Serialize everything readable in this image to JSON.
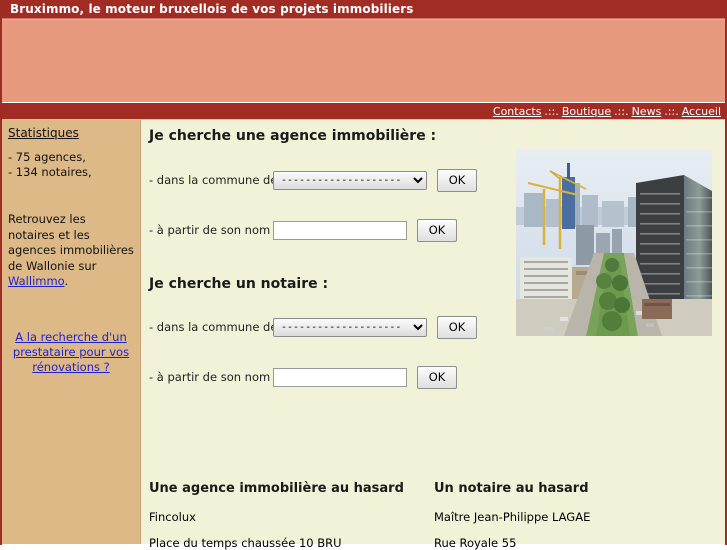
{
  "window": {
    "title": "Bruximmo, le moteur bruxellois de vos projets immobiliers"
  },
  "nav": {
    "separator": ".::.",
    "links": [
      {
        "label": "Contacts"
      },
      {
        "label": "Boutique"
      },
      {
        "label": "News"
      },
      {
        "label": "Accueil"
      }
    ]
  },
  "sidebar": {
    "stats_title": "Statistiques",
    "stats": [
      "- 75 agences,",
      "- 134 notaires,"
    ],
    "promo_before": "Retrouvez les notaires et les agences immobilières de Wallonie sur ",
    "promo_link": "Wallimmo",
    "promo_after": ".",
    "reno_link_line1": "A la recherche d'un",
    "reno_link_line2": "prestataire pour vos",
    "reno_link_line3": "rénovations ?"
  },
  "main": {
    "agency_section": {
      "heading": "Je cherche une agence immobilière :",
      "commune_label": "- dans la commune de",
      "commune_value": "--------------------",
      "commune_ok": "OK",
      "name_label": "- à partir de son nom",
      "name_value": "",
      "name_placeholder": "",
      "name_ok": "OK"
    },
    "notary_section": {
      "heading": "Je cherche un notaire :",
      "commune_label": "- dans la commune de",
      "commune_value": "--------------------",
      "commune_ok": "OK",
      "name_label": "- à partir de son nom",
      "name_value": "",
      "name_placeholder": "",
      "name_ok": "OK"
    },
    "random_agency": {
      "heading": "Une agence immobilière au hasard",
      "name": "Fincolux",
      "address": "Place du temps chaussée 10 BRU"
    },
    "random_notary": {
      "heading": "Un notaire au hasard",
      "name": "Maître Jean-Philippe LAGAE",
      "address": "Rue Royale 55"
    },
    "photo_alt": "brussels-cityscape-photo"
  },
  "colors": {
    "title_bar": "#a02c24",
    "banner": "#e89a7e",
    "sidebar": "#ddb988",
    "main_bg": "#f2f2d8",
    "link": "#2222cc"
  }
}
